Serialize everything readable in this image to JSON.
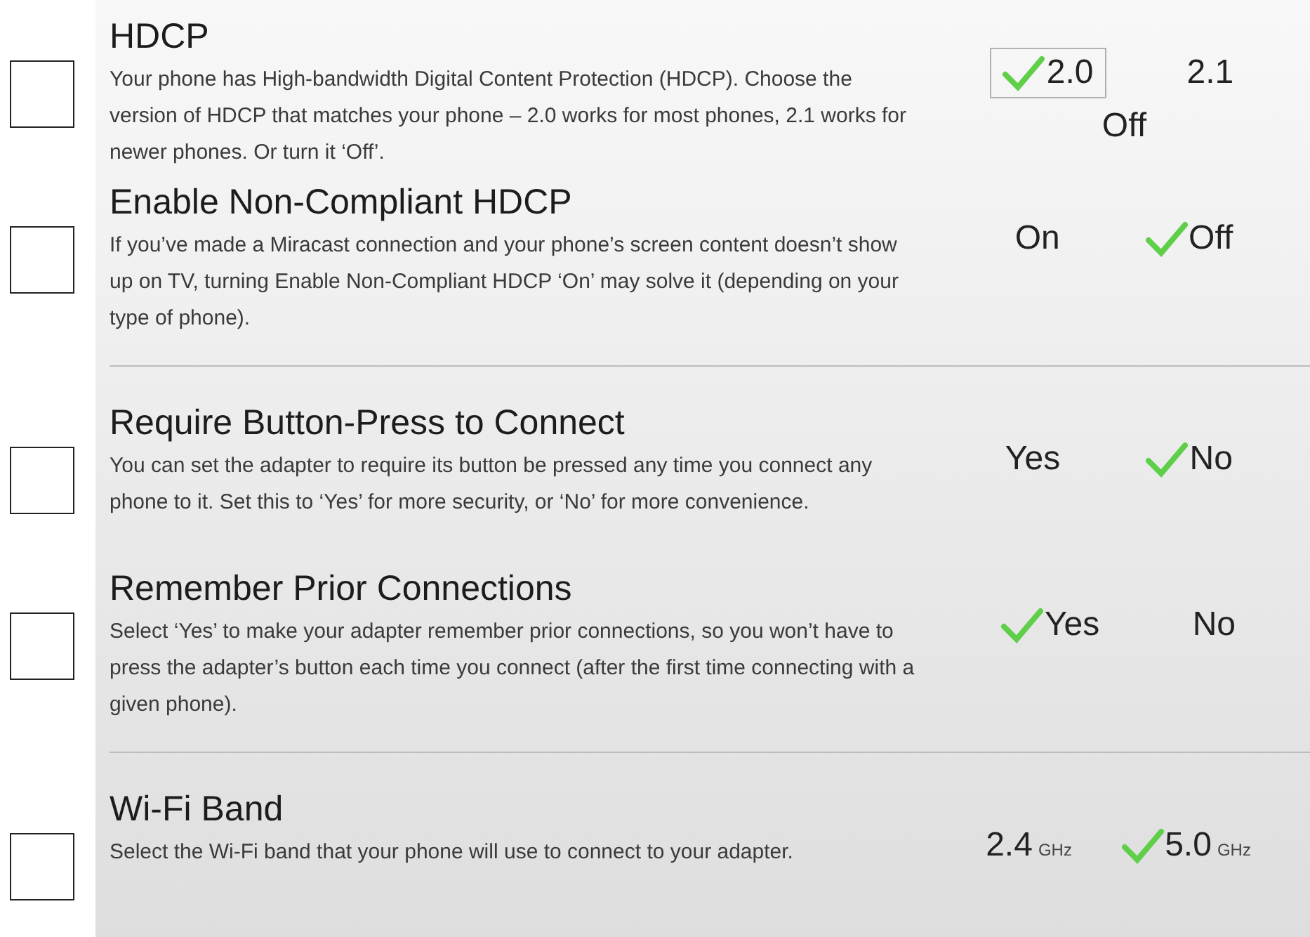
{
  "groups": [
    {
      "settings": [
        {
          "title": "HDCP",
          "description": "Your phone has High-bandwidth Digital Content Protection (HDCP). Choose the version of HDCP that matches your phone – 2.0 works for most phones, 2.1 works for newer phones.  Or turn it ‘Off’.",
          "options": [
            {
              "label": "2.0",
              "selected": true,
              "focused": true
            },
            {
              "label": "2.1",
              "selected": false,
              "focused": false
            },
            {
              "label": "Off",
              "selected": false,
              "focused": false
            }
          ]
        },
        {
          "title": "Enable Non-Compliant HDCP",
          "description": "If you’ve made a Miracast connection and your phone’s screen content doesn’t show up on TV, turning Enable Non-Compliant HDCP ‘On’ may solve it (depending on your type of phone).",
          "options": [
            {
              "label": "On",
              "selected": false,
              "focused": false
            },
            {
              "label": "Off",
              "selected": true,
              "focused": false
            }
          ]
        }
      ]
    },
    {
      "settings": [
        {
          "title": "Require Button-Press to Connect",
          "description": "You can set the adapter to require its button be pressed any time you connect any phone to it.  Set this to ‘Yes’ for more security, or ‘No’ for more convenience.",
          "options": [
            {
              "label": "Yes",
              "selected": false,
              "focused": false
            },
            {
              "label": "No",
              "selected": true,
              "focused": false
            }
          ]
        },
        {
          "title": "Remember Prior Connections",
          "description": "Select ‘Yes’ to make your adapter remember prior connections, so you won’t have to press the adapter’s button each time you connect (after the first time connecting with a given phone).",
          "options": [
            {
              "label": "Yes",
              "selected": true,
              "focused": false
            },
            {
              "label": "No",
              "selected": false,
              "focused": false
            }
          ]
        }
      ]
    },
    {
      "settings": [
        {
          "title": "Wi-Fi Band",
          "description": "Select the Wi-Fi band that your phone will use to connect to your adapter.",
          "options": [
            {
              "label": "2.4",
              "unit": "GHz",
              "selected": false,
              "focused": false
            },
            {
              "label": "5.0",
              "unit": "GHz",
              "selected": true,
              "focused": false
            }
          ]
        }
      ]
    }
  ]
}
